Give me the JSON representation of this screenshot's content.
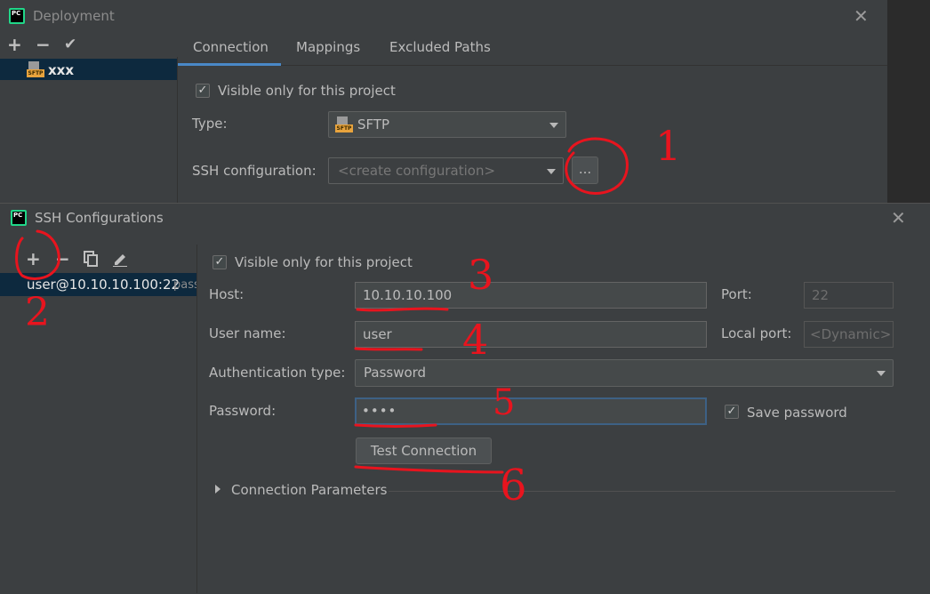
{
  "deployment": {
    "title": "Deployment",
    "toolbar": {
      "add": "+",
      "remove": "−",
      "apply": "✔"
    },
    "server_item": "xxx",
    "tabs": [
      "Connection",
      "Mappings",
      "Excluded Paths"
    ],
    "visible_only_label": "Visible only for this project",
    "type_label": "Type:",
    "type_value": "SFTP",
    "ssh_config_label": "SSH configuration:",
    "ssh_config_value": "<create configuration>",
    "browse_button": "..."
  },
  "ssh": {
    "title": "SSH Configurations",
    "list_item": "user@10.10.10.100:22",
    "list_item_suffix": "pass",
    "visible_only_label": "Visible only for this project",
    "host_label": "Host:",
    "host_value": "10.10.10.100",
    "port_label": "Port:",
    "port_value": "22",
    "user_label": "User name:",
    "user_value": "user",
    "local_port_label": "Local port:",
    "local_port_value": "<Dynamic>",
    "auth_label": "Authentication type:",
    "auth_value": "Password",
    "password_label": "Password:",
    "password_value": "••••",
    "save_password_label": "Save password",
    "test_button": "Test Connection",
    "conn_params_label": "Connection Parameters"
  },
  "annotations": [
    "1",
    "2",
    "3",
    "4",
    "5",
    "6"
  ],
  "colors": {
    "accent": "#4a88c7",
    "selection": "#0d293e",
    "annotation": "#e8141e"
  }
}
